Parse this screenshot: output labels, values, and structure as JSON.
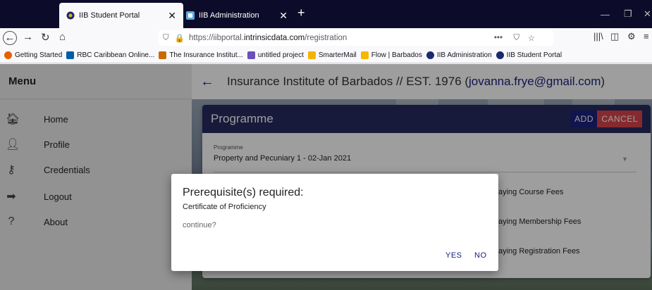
{
  "browser": {
    "tabs": [
      {
        "title": "IIB Student Portal",
        "active": true
      },
      {
        "title": "IIB Administration",
        "active": false
      }
    ],
    "url_prefix": "https://iibportal.",
    "url_domain": "intrinsicdata.com",
    "url_path": "/registration",
    "bookmarks": [
      "Getting Started",
      "RBC Caribbean Online...",
      "The Insurance Institut...",
      "untitled project",
      "SmarterMail",
      "Flow | Barbados",
      "IIB Administration",
      "IIB Student Portal"
    ]
  },
  "sidebar": {
    "title": "Menu",
    "items": [
      {
        "label": "Home",
        "icon": "home-icon"
      },
      {
        "label": "Profile",
        "icon": "person-icon"
      },
      {
        "label": "Credentials",
        "icon": "key-icon"
      },
      {
        "label": "Logout",
        "icon": "logout-icon"
      },
      {
        "label": "About",
        "icon": "question-icon"
      }
    ]
  },
  "header": {
    "title_prefix": "Insurance Institute of Barbados // EST. 1976 (",
    "email": "jovanna.frye@gmail.com",
    "title_suffix": ")"
  },
  "card": {
    "title": "Programme",
    "add_label": "ADD",
    "cancel_label": "CANCEL",
    "field_label": "Programme",
    "field_value": "Property and Pecuniary 1 - 02-Jan 2021",
    "options": [
      "aying Course Fees",
      "aying Membership Fees",
      "aying Registration Fees"
    ]
  },
  "dialog": {
    "title": "Prerequisite(s) required:",
    "subtitle": "Certificate of Proficiency",
    "question": "continue?",
    "yes_label": "YES",
    "no_label": "NO"
  },
  "colors": {
    "primary": "#1a237e",
    "card_header": "#262a5e",
    "cancel": "#d9454d"
  }
}
